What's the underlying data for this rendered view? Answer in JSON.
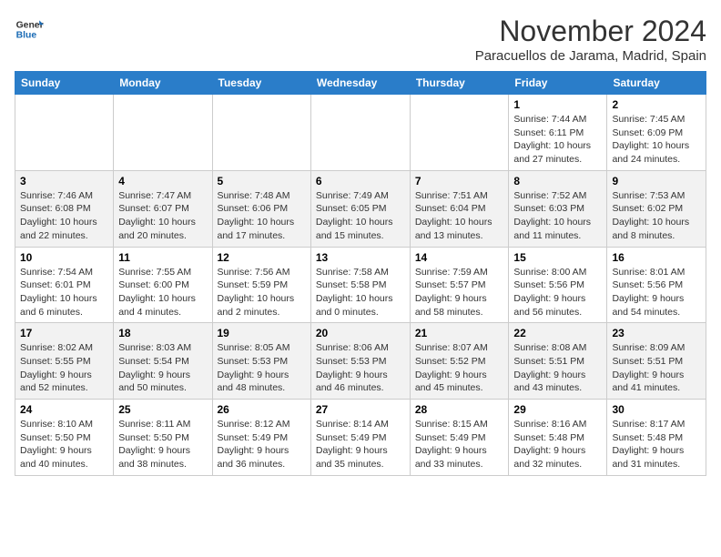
{
  "logo": {
    "line1": "General",
    "line2": "Blue"
  },
  "header": {
    "title": "November 2024",
    "subtitle": "Paracuellos de Jarama, Madrid, Spain"
  },
  "weekdays": [
    "Sunday",
    "Monday",
    "Tuesday",
    "Wednesday",
    "Thursday",
    "Friday",
    "Saturday"
  ],
  "weeks": [
    [
      {
        "day": "",
        "info": ""
      },
      {
        "day": "",
        "info": ""
      },
      {
        "day": "",
        "info": ""
      },
      {
        "day": "",
        "info": ""
      },
      {
        "day": "",
        "info": ""
      },
      {
        "day": "1",
        "info": "Sunrise: 7:44 AM\nSunset: 6:11 PM\nDaylight: 10 hours and 27 minutes."
      },
      {
        "day": "2",
        "info": "Sunrise: 7:45 AM\nSunset: 6:09 PM\nDaylight: 10 hours and 24 minutes."
      }
    ],
    [
      {
        "day": "3",
        "info": "Sunrise: 7:46 AM\nSunset: 6:08 PM\nDaylight: 10 hours and 22 minutes."
      },
      {
        "day": "4",
        "info": "Sunrise: 7:47 AM\nSunset: 6:07 PM\nDaylight: 10 hours and 20 minutes."
      },
      {
        "day": "5",
        "info": "Sunrise: 7:48 AM\nSunset: 6:06 PM\nDaylight: 10 hours and 17 minutes."
      },
      {
        "day": "6",
        "info": "Sunrise: 7:49 AM\nSunset: 6:05 PM\nDaylight: 10 hours and 15 minutes."
      },
      {
        "day": "7",
        "info": "Sunrise: 7:51 AM\nSunset: 6:04 PM\nDaylight: 10 hours and 13 minutes."
      },
      {
        "day": "8",
        "info": "Sunrise: 7:52 AM\nSunset: 6:03 PM\nDaylight: 10 hours and 11 minutes."
      },
      {
        "day": "9",
        "info": "Sunrise: 7:53 AM\nSunset: 6:02 PM\nDaylight: 10 hours and 8 minutes."
      }
    ],
    [
      {
        "day": "10",
        "info": "Sunrise: 7:54 AM\nSunset: 6:01 PM\nDaylight: 10 hours and 6 minutes."
      },
      {
        "day": "11",
        "info": "Sunrise: 7:55 AM\nSunset: 6:00 PM\nDaylight: 10 hours and 4 minutes."
      },
      {
        "day": "12",
        "info": "Sunrise: 7:56 AM\nSunset: 5:59 PM\nDaylight: 10 hours and 2 minutes."
      },
      {
        "day": "13",
        "info": "Sunrise: 7:58 AM\nSunset: 5:58 PM\nDaylight: 10 hours and 0 minutes."
      },
      {
        "day": "14",
        "info": "Sunrise: 7:59 AM\nSunset: 5:57 PM\nDaylight: 9 hours and 58 minutes."
      },
      {
        "day": "15",
        "info": "Sunrise: 8:00 AM\nSunset: 5:56 PM\nDaylight: 9 hours and 56 minutes."
      },
      {
        "day": "16",
        "info": "Sunrise: 8:01 AM\nSunset: 5:56 PM\nDaylight: 9 hours and 54 minutes."
      }
    ],
    [
      {
        "day": "17",
        "info": "Sunrise: 8:02 AM\nSunset: 5:55 PM\nDaylight: 9 hours and 52 minutes."
      },
      {
        "day": "18",
        "info": "Sunrise: 8:03 AM\nSunset: 5:54 PM\nDaylight: 9 hours and 50 minutes."
      },
      {
        "day": "19",
        "info": "Sunrise: 8:05 AM\nSunset: 5:53 PM\nDaylight: 9 hours and 48 minutes."
      },
      {
        "day": "20",
        "info": "Sunrise: 8:06 AM\nSunset: 5:53 PM\nDaylight: 9 hours and 46 minutes."
      },
      {
        "day": "21",
        "info": "Sunrise: 8:07 AM\nSunset: 5:52 PM\nDaylight: 9 hours and 45 minutes."
      },
      {
        "day": "22",
        "info": "Sunrise: 8:08 AM\nSunset: 5:51 PM\nDaylight: 9 hours and 43 minutes."
      },
      {
        "day": "23",
        "info": "Sunrise: 8:09 AM\nSunset: 5:51 PM\nDaylight: 9 hours and 41 minutes."
      }
    ],
    [
      {
        "day": "24",
        "info": "Sunrise: 8:10 AM\nSunset: 5:50 PM\nDaylight: 9 hours and 40 minutes."
      },
      {
        "day": "25",
        "info": "Sunrise: 8:11 AM\nSunset: 5:50 PM\nDaylight: 9 hours and 38 minutes."
      },
      {
        "day": "26",
        "info": "Sunrise: 8:12 AM\nSunset: 5:49 PM\nDaylight: 9 hours and 36 minutes."
      },
      {
        "day": "27",
        "info": "Sunrise: 8:14 AM\nSunset: 5:49 PM\nDaylight: 9 hours and 35 minutes."
      },
      {
        "day": "28",
        "info": "Sunrise: 8:15 AM\nSunset: 5:49 PM\nDaylight: 9 hours and 33 minutes."
      },
      {
        "day": "29",
        "info": "Sunrise: 8:16 AM\nSunset: 5:48 PM\nDaylight: 9 hours and 32 minutes."
      },
      {
        "day": "30",
        "info": "Sunrise: 8:17 AM\nSunset: 5:48 PM\nDaylight: 9 hours and 31 minutes."
      }
    ]
  ]
}
